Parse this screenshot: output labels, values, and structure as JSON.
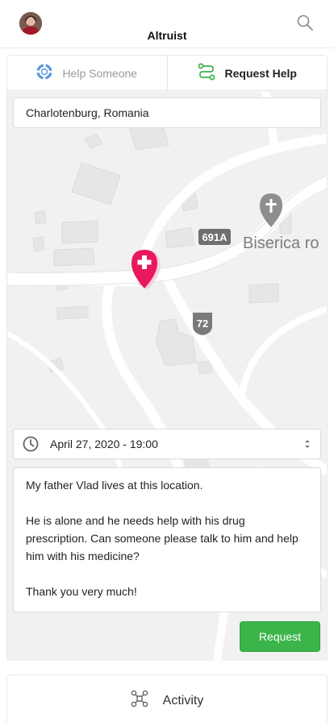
{
  "header": {
    "title": "Altruist",
    "avatar_icon": "user-avatar",
    "search_icon": "search-icon"
  },
  "tabs": [
    {
      "label": "Help Someone",
      "icon": "lifebuoy-icon",
      "active": false,
      "color": "#4a90e2"
    },
    {
      "label": "Request Help",
      "icon": "route-icon",
      "active": true,
      "color": "#3bb54a"
    }
  ],
  "location": {
    "value": "Charlotenburg, Romania"
  },
  "map": {
    "road_labels": [
      "691A",
      "72"
    ],
    "poi_label": "Biserica ro",
    "marker_color": "#e8185a"
  },
  "datetime": {
    "value": "April 27, 2020 - 19:00"
  },
  "message": {
    "text": "My father Vlad lives at this location.\n\nHe is alone and he needs help with his drug prescription. Can someone please talk to him and help him with his medicine?\n\nThank you very much!"
  },
  "request_button": {
    "label": "Request",
    "color": "#3bb54a"
  },
  "activity": {
    "label": "Activity",
    "icon": "network-icon"
  }
}
